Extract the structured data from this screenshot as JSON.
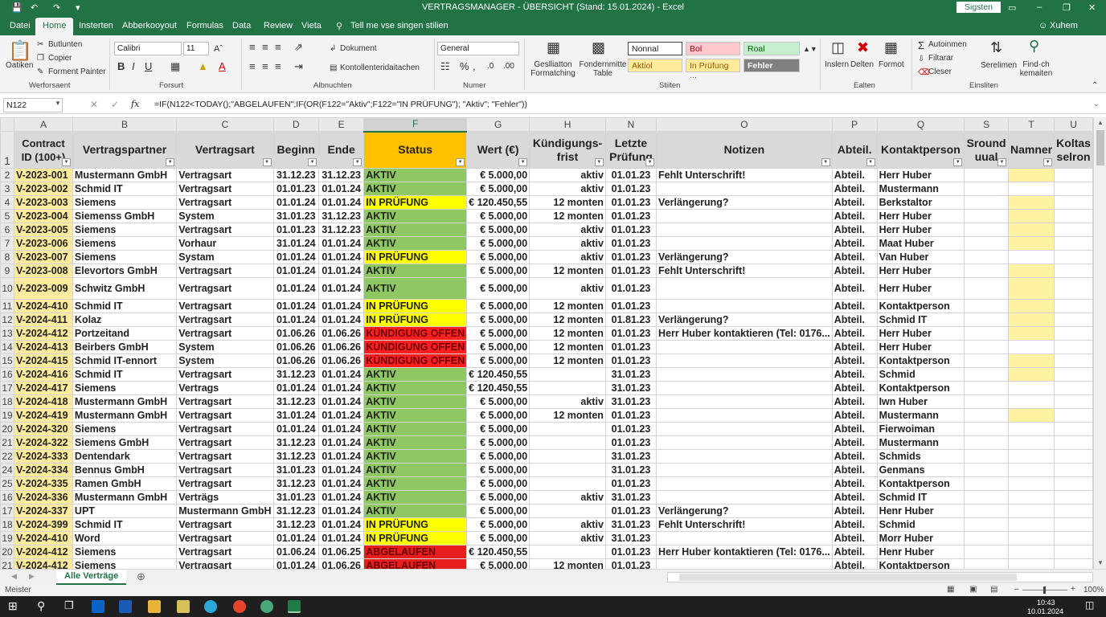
{
  "title_bar": {
    "title": "VERTRAGSMANAGER - ÜBERSICHT (Stand: 15.01.2024) - Excel",
    "signin": "Sigsten"
  },
  "menu": {
    "tabs": [
      "Datei",
      "Home",
      "Insterten",
      "Abberkooyout",
      "Formulas",
      "Data",
      "Review",
      "Vieta"
    ],
    "active": "Home",
    "tell_me": "Tell me vse singen stilien",
    "user": "Xuhem"
  },
  "ribbon": {
    "clipboard": {
      "paste": "Oatiken",
      "cut": "Butlunten",
      "copy": "Copier",
      "painter": "Forment Painter",
      "label": "Werforsaent"
    },
    "font": {
      "name": "Calibri",
      "size": "11",
      "bold": "B",
      "italic": "I",
      "underline": "U",
      "label": "Forsurt"
    },
    "alignment": {
      "wrap": "Dokument",
      "merge": "Kontollenteridaitachen",
      "label": "Albnuchten"
    },
    "number": {
      "format": "General",
      "label": "Numer"
    },
    "styles": {
      "cond": "Geslliatton Formatching",
      "table": "Fondernmitte Table",
      "cells": [
        "Nonnal",
        "Bol",
        "Roal",
        "Aktiol",
        "In Prüfung ...",
        "Fehler"
      ],
      "label": "Stiiten"
    },
    "cells": {
      "insert": "Inslern",
      "delete": "Delten",
      "format": "Formot",
      "label": "Ealten"
    },
    "editing": {
      "autosum": "Autoinmen",
      "fill": "Filtarar",
      "clear": "Cleser",
      "sort": "Serelimen",
      "find": "Find·ch kemaiten",
      "label": "Einsliten"
    }
  },
  "formula_bar": {
    "namebox": "N122",
    "fx": "fx",
    "formula": "=IF(N122<TODAY();\"ABGELAUFEN\";IF(OR(F122=\"Aktiv\";F122=\"IN PRÜFUNG\"); \"Aktiv\"; \"Fehler\"))"
  },
  "columns": [
    "A",
    "B",
    "C",
    "D",
    "E",
    "F",
    "G",
    "H",
    "N",
    "O",
    "P",
    "Q",
    "S",
    "T",
    "U"
  ],
  "headers": [
    "Contract ID (100+)",
    "Vertragspartner",
    "Vertragsart",
    "Beginn",
    "Ende",
    "Status",
    "Wert (€)",
    "Kündigungs-frist",
    "Letzte Prüfung",
    "Notizen",
    "Abteil.",
    "Kontaktperson",
    "Sround uual",
    "Namner",
    "Koltas selron"
  ],
  "rows": [
    {
      "n": "2",
      "id": "V-2023-001",
      "partner": "Mustermann GmbH",
      "art": "Vertragsart",
      "beg": "31.12.23",
      "end": "31.12.23",
      "status": "AKTIV",
      "st": "AKTIV",
      "wert": "€ 5.000,00",
      "kf": "aktiv",
      "lp": "01.01.23",
      "notiz": "Fehlt Unterschrift!",
      "abt": "Abteil.",
      "kp": "Herr Huber",
      "nm": true
    },
    {
      "n": "3",
      "id": "V-2023-002",
      "partner": "Schmid IT",
      "art": "Vertragsart",
      "beg": "01.01.23",
      "end": "01.01.24",
      "status": "AKTIV",
      "st": "AKTIV",
      "wert": "€ 5.000,00",
      "kf": "aktiv",
      "lp": "01.01.23",
      "notiz": "",
      "abt": "Abteil.",
      "kp": "Mustermann",
      "nm": false
    },
    {
      "n": "4",
      "id": "V-2023-003",
      "partner": "Siemens",
      "art": "Vertragsart",
      "beg": "01.01.24",
      "end": "01.01.24",
      "status": "IN PRÜFUNG",
      "st": "PRUEF",
      "wert": "€ 120.450,55",
      "kf": "12 monten",
      "lp": "01.01.23",
      "notiz": "Verlängerung?",
      "abt": "Abteil.",
      "kp": "Berkstaltor",
      "nm": true
    },
    {
      "n": "5",
      "id": "V-2023-004",
      "partner": "Siemenss GmbH",
      "art": "System",
      "beg": "31.01.23",
      "end": "31.12.23",
      "status": "AKTIV",
      "st": "AKTIV",
      "wert": "€ 5.000,00",
      "kf": "12 monten",
      "lp": "01.01.23",
      "notiz": "",
      "abt": "Abteil.",
      "kp": "Herr Huber",
      "nm": true
    },
    {
      "n": "6",
      "id": "V-2023-005",
      "partner": "Siemens",
      "art": "Vertragsart",
      "beg": "01.01.23",
      "end": "31.12.23",
      "status": "AKTIV",
      "st": "AKTIV",
      "wert": "€ 5.000,00",
      "kf": "aktiv",
      "lp": "01.01.23",
      "notiz": "",
      "abt": "Abteil.",
      "kp": "Herr Huber",
      "nm": true
    },
    {
      "n": "7",
      "id": "V-2023-006",
      "partner": "Siemens",
      "art": "Vorhaur",
      "beg": "31.01.24",
      "end": "01.01.24",
      "status": "AKTIV",
      "st": "AKTIV",
      "wert": "€ 5.000,00",
      "kf": "aktiv",
      "lp": "01.01.23",
      "notiz": "",
      "abt": "Abteil.",
      "kp": "Maat Huber",
      "nm": true
    },
    {
      "n": "8",
      "id": "V-2023-007",
      "partner": "Siemens",
      "art": "Systam",
      "beg": "01.01.24",
      "end": "01.01.24",
      "status": "IN PRÜFUNG",
      "st": "PRUEF",
      "wert": "€ 5.000,00",
      "kf": "aktiv",
      "lp": "01.01.23",
      "notiz": "Verlängerung?",
      "abt": "Abteil.",
      "kp": "Van Huber",
      "nm": false
    },
    {
      "n": "9",
      "id": "V-2023-008",
      "partner": "Elevortors GmbH",
      "art": "Vertragsart",
      "beg": "01.01.24",
      "end": "01.01.24",
      "status": "AKTIV",
      "st": "AKTIV",
      "wert": "€ 5.000,00",
      "kf": "12 monten",
      "lp": "01.01.23",
      "notiz": "Fehlt Unterschrift!",
      "abt": "Abteil.",
      "kp": "Herr Huber",
      "nm": true
    },
    {
      "n": "10",
      "id": "V-2023-009",
      "partner": "Schwitz GmbH",
      "art": "Vertragsart",
      "beg": "01.01.24",
      "end": "01.01.24",
      "status": "AKTIV",
      "st": "AKTIV",
      "wert": "€ 5.000,00",
      "kf": "aktiv",
      "lp": "01.01.23",
      "notiz": "",
      "abt": "Abteil.",
      "kp": "Herr Huber",
      "nm": true,
      "tall": true
    },
    {
      "n": "11",
      "id": "V-2024-410",
      "partner": "Schmid IT",
      "art": "Vertragsart",
      "beg": "01.01.24",
      "end": "01.01.24",
      "status": "IN PRÜFUNG",
      "st": "PRUEF",
      "wert": "€ 5.000,00",
      "kf": "12 monten",
      "lp": "01.01.23",
      "notiz": "",
      "abt": "Abteil.",
      "kp": "Kontaktperson",
      "nm": true
    },
    {
      "n": "12",
      "id": "V-2024-411",
      "partner": "Kolaz",
      "art": "Vertragsart",
      "beg": "01.01.24",
      "end": "01.01.24",
      "status": "IN PRÜFUNG",
      "st": "PRUEF",
      "wert": "€ 5.000,00",
      "kf": "12 monten",
      "lp": "01.81.23",
      "notiz": "Verlängerung?",
      "abt": "Abteil.",
      "kp": "Schmid IT",
      "nm": true
    },
    {
      "n": "13",
      "id": "V-2024-412",
      "partner": "Portzeitand",
      "art": "Vertragsart",
      "beg": "01.06.26",
      "end": "01.06.26",
      "status": "KÜNDIGUNG OFFEN",
      "st": "KUEND",
      "wert": "€ 5.000,00",
      "kf": "12 monten",
      "lp": "01.01.23",
      "notiz": "Herr Huber kontaktieren (Tel: 0176...",
      "abt": "Abteil.",
      "kp": "Herr Huber",
      "nm": true
    },
    {
      "n": "14",
      "id": "V-2024-413",
      "partner": "Beirbers GmbH",
      "art": "System",
      "beg": "01.06.26",
      "end": "01.06.26",
      "status": "KÜNDIGUNG OFFEN",
      "st": "KUEND",
      "wert": "€ 5.000,00",
      "kf": "12 monten",
      "lp": "01.01.23",
      "notiz": "",
      "abt": "Abteil.",
      "kp": "Herr Huber",
      "nm": false
    },
    {
      "n": "15",
      "id": "V-2024-415",
      "partner": "Schmid IT-ennort",
      "art": "System",
      "beg": "01.06.26",
      "end": "01.06.26",
      "status": "KÜNDIGUNG OFFEN",
      "st": "KUEND",
      "wert": "€ 5.000,00",
      "kf": "12 monten",
      "lp": "01.01.23",
      "notiz": "",
      "abt": "Abteil.",
      "kp": "Kontaktperson",
      "nm": true
    },
    {
      "n": "16",
      "id": "V-2024-416",
      "partner": "Schmid IT",
      "art": "Vertragsart",
      "beg": "31.12.23",
      "end": "01.01.24",
      "status": "AKTIV",
      "st": "AKTIV",
      "wert": "€ 120.450,55",
      "kf": "",
      "lp": "31.01.23",
      "notiz": "",
      "abt": "Abteil.",
      "kp": "Schmid",
      "nm": true
    },
    {
      "n": "17",
      "id": "V-2024-417",
      "partner": "Siemens",
      "art": "Vertrags",
      "beg": "01.01.24",
      "end": "01.01.24",
      "status": "AKTIV",
      "st": "AKTIV",
      "wert": "€ 120.450,55",
      "kf": "",
      "lp": "31.01.23",
      "notiz": "",
      "abt": "Abteil.",
      "kp": "Kontaktperson",
      "nm": false
    },
    {
      "n": "18",
      "id": "V-2024-418",
      "partner": "Mustermann GmbH",
      "art": "Vertragsart",
      "beg": "31.12.23",
      "end": "01.01.24",
      "status": "AKTIV",
      "st": "AKTIV",
      "wert": "€ 5.000,00",
      "kf": "aktiv",
      "lp": "31.01.23",
      "notiz": "",
      "abt": "Abteil.",
      "kp": "Iwn Huber",
      "nm": false
    },
    {
      "n": "19",
      "id": "V-2024-419",
      "partner": "Mustermann GmbH",
      "art": "Vertragsart",
      "beg": "31.01.24",
      "end": "01.01.24",
      "status": "AKTIV",
      "st": "AKTIV",
      "wert": "€ 5.000,00",
      "kf": "12 monten",
      "lp": "01.01.23",
      "notiz": "",
      "abt": "Abteil.",
      "kp": "Mustermann",
      "nm": true
    },
    {
      "n": "20",
      "id": "V-2024-320",
      "partner": "Siemens",
      "art": "Vertragsart",
      "beg": "01.01.24",
      "end": "01.01.24",
      "status": "AKTIV",
      "st": "AKTIV",
      "wert": "€ 5.000,00",
      "kf": "",
      "lp": "01.01.23",
      "notiz": "",
      "abt": "Abteil.",
      "kp": "Fierwoiman",
      "nm": false
    },
    {
      "n": "21",
      "id": "V-2024-322",
      "partner": "Siemens GmbH",
      "art": "Vertragsart",
      "beg": "31.12.23",
      "end": "01.01.24",
      "status": "AKTIV",
      "st": "AKTIV",
      "wert": "€ 5.000,00",
      "kf": "",
      "lp": "01.01.23",
      "notiz": "",
      "abt": "Abteil.",
      "kp": "Mustermann",
      "nm": false
    },
    {
      "n": "22",
      "id": "V-2024-333",
      "partner": "Dentendark",
      "art": "Vertragsart",
      "beg": "31.12.23",
      "end": "01.01.24",
      "status": "AKTIV",
      "st": "AKTIV",
      "wert": "€ 5.000,00",
      "kf": "",
      "lp": "31.01.23",
      "notiz": "",
      "abt": "Abteil.",
      "kp": "Schmids",
      "nm": false
    },
    {
      "n": "24",
      "id": "V-2024-334",
      "partner": "Bennus GmbH",
      "art": "Vertragsart",
      "beg": "31.01.23",
      "end": "01.01.24",
      "status": "AKTIV",
      "st": "AKTIV",
      "wert": "€ 5.000,00",
      "kf": "",
      "lp": "31.01.23",
      "notiz": "",
      "abt": "Abteil.",
      "kp": "Genmans",
      "nm": false
    },
    {
      "n": "25",
      "id": "V-2024-335",
      "partner": "Ramen GmbH",
      "art": "Vertragsart",
      "beg": "31.12.23",
      "end": "01.01.24",
      "status": "AKTIV",
      "st": "AKTIV",
      "wert": "€ 5.000,00",
      "kf": "",
      "lp": "01.01.23",
      "notiz": "",
      "abt": "Abteil.",
      "kp": "Kontaktperson",
      "nm": false
    },
    {
      "n": "16",
      "id": "V-2024-336",
      "partner": "Mustermann GmbH",
      "art": "Verträgs",
      "beg": "31.01.23",
      "end": "01.01.24",
      "status": "AKTIV",
      "st": "AKTIV",
      "wert": "€ 5.000,00",
      "kf": "aktiv",
      "lp": "31.01.23",
      "notiz": "",
      "abt": "Abteil.",
      "kp": "Schmid IT",
      "nm": false
    },
    {
      "n": "17",
      "id": "V-2024-337",
      "partner": "UPT",
      "art": "Mustermann GmbH",
      "beg": "31.12.23",
      "end": "01.01.24",
      "status": "AKTIV",
      "st": "AKTIV",
      "wert": "€ 5.000,00",
      "kf": "",
      "lp": "01.01.23",
      "notiz": "Verlängerung?",
      "abt": "Abteil.",
      "kp": "Henr Huber",
      "nm": false
    },
    {
      "n": "18",
      "id": "V-2024-399",
      "partner": "Schmid IT",
      "art": "Vertragsart",
      "beg": "31.12.23",
      "end": "01.01.24",
      "status": "IN PRÜFUNG",
      "st": "PRUEF",
      "wert": "€ 5.000,00",
      "kf": "aktiv",
      "lp": "31.01.23",
      "notiz": "Fehlt Unterschrift!",
      "abt": "Abteil.",
      "kp": "Schmid",
      "nm": false
    },
    {
      "n": "19",
      "id": "V-2024-410",
      "partner": "Word",
      "art": "Vertragsart",
      "beg": "01.01.24",
      "end": "01.01.24",
      "status": "IN PRÜFUNG",
      "st": "PRUEF",
      "wert": "€ 5.000,00",
      "kf": "aktiv",
      "lp": "31.01.23",
      "notiz": "",
      "abt": "Abteil.",
      "kp": "Morr Huber",
      "nm": false
    },
    {
      "n": "20",
      "id": "V-2024-412",
      "partner": "Siemens",
      "art": "Vertragsart",
      "beg": "01.06.24",
      "end": "01.06.25",
      "status": "ABGELAUFEN",
      "st": "ABGEL",
      "wert": "€ 120.450,55",
      "kf": "",
      "lp": "01.01.23",
      "notiz": "Herr Huber kontaktieren (Tel: 0176...",
      "abt": "Abteil.",
      "kp": "Henr Huber",
      "nm": false
    },
    {
      "n": "21",
      "id": "V-2024-412",
      "partner": "Siemens",
      "art": "Vertragsart",
      "beg": "01.01.24",
      "end": "01.06.26",
      "status": "ABGELAUFEN",
      "st": "ABGEL",
      "wert": "€ 5.000,00",
      "kf": "12 monten",
      "lp": "01.01.23",
      "notiz": "",
      "abt": "Abteil.",
      "kp": "Kontaktperson",
      "nm": false
    }
  ],
  "sheet_tabs": [
    "Alle Verträge"
  ],
  "status": {
    "left": "Meister",
    "zoom": "100%"
  },
  "taskbar": {
    "time": "10:43",
    "date": "10.01.2024"
  }
}
